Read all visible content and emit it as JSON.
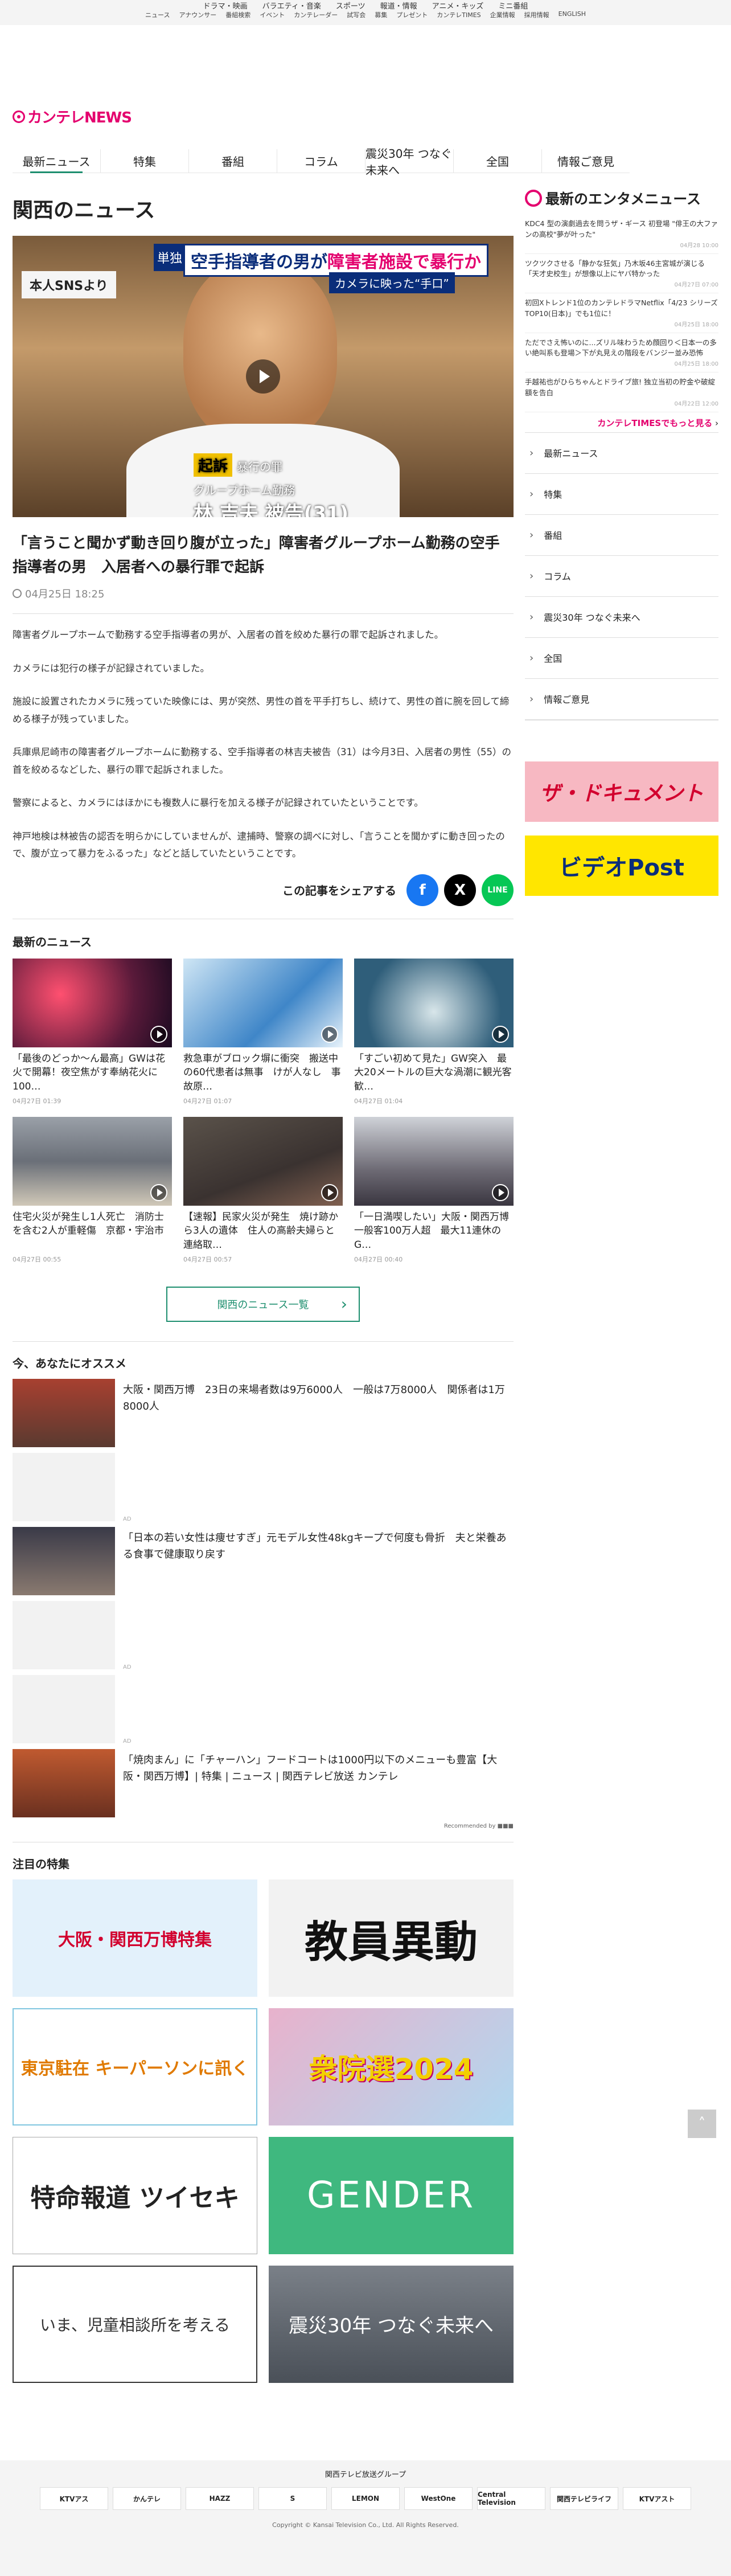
{
  "topbar": {
    "primary": [
      "ドラマ・映画",
      "バラエティ・音楽",
      "スポーツ",
      "報道・情報",
      "アニメ・キッズ",
      "ミニ番組"
    ],
    "secondary": [
      "ニュース",
      "アナウンサー",
      "番組検索",
      "イベント",
      "カンテレーダー",
      "試写会",
      "募集",
      "プレゼント",
      "カンテレTIMES",
      "企業情報",
      "採用情報",
      "ENGLISH"
    ]
  },
  "logo": {
    "text": "カンテレNEWS"
  },
  "nav": [
    "最新ニュース",
    "特集",
    "番組",
    "コラム",
    "震災30年 つなぐ未来へ",
    "全国",
    "情報ご意見"
  ],
  "page_title": "関西のニュース",
  "hero": {
    "tag": "単独",
    "top_text_a": "空手指導者の男が",
    "top_text_b": "障害者施設で暴行か",
    "sub": "カメラに映った“手口”",
    "sns": "本人SNSより",
    "cap_k": "起訴",
    "cap_k2": "暴行の罪",
    "cap_l2": "グループホーム勤務",
    "cap_l3": "林 吉夫 被告(31)"
  },
  "article": {
    "headline": "「言うこと聞かず動き回り腹が立った」障害者グループホーム勤務の空手指導者の男　入居者への暴行罪で起訴",
    "date": "04月25日 18:25",
    "paragraphs": [
      "障害者グループホームで勤務する空手指導者の男が、入居者の首を絞めた暴行の罪で起訴されました。",
      "カメラには犯行の様子が記録されていました。",
      "施設に設置されたカメラに残っていた映像には、男が突然、男性の首を平手打ちし、続けて、男性の首に腕を回して締める様子が残っていました。",
      "兵庫県尼崎市の障害者グループホームに勤務する、空手指導者の林吉夫被告（31）は今月3日、入居者の男性（55）の首を絞めるなどした、暴行の罪で起訴されました。",
      "警察によると、カメラにはほかにも複数人に暴行を加える様子が記録されていたということです。",
      "神戸地検は林被告の認否を明らかにしていませんが、逮捕時、警察の調べに対し、「言うことを聞かずに動き回ったので、腹が立って暴力をふるった」などと話していたということです。"
    ],
    "share_label": "この記事をシェアする"
  },
  "latest": {
    "title": "最新のニュース",
    "items": [
      {
        "title": "「最後のどっか〜ん最高」GWは花火で開幕！夜空焦がす奉納花火に100…",
        "date": "04月27日 01:39",
        "color": "#5a1a3a"
      },
      {
        "title": "救急車がブロック塀に衝突　搬送中の60代患者は無事　けが人なし　事故原…",
        "date": "04月27日 01:07",
        "color": "#3f86c8"
      },
      {
        "title": "「すごい初めて見た」GW突入　最大20メートルの巨大な渦潮に観光客歓…",
        "date": "04月27日 01:04",
        "color": "#2f5e7a"
      },
      {
        "title": "住宅火災が発生し1人死亡　消防士を含む2人が重軽傷　京都・宇治市",
        "date": "04月27日 00:55",
        "color": "#6a6f78"
      },
      {
        "title": "【速報】民家火災が発生　焼け跡から3人の遺体　住人の高齢夫婦らと連絡取…",
        "date": "04月27日 00:57",
        "color": "#3a3230"
      },
      {
        "title": "「一日満喫したい」大阪・関西万博　一般客100万人超　最大11連休のG…",
        "date": "04月27日 00:40",
        "color": "#6d6a74"
      }
    ],
    "more": "関西のニュース一覧"
  },
  "recommend": {
    "title": "今、あなたにオススメ",
    "items": [
      {
        "text": "大阪・関西万博　23日の来場者数は9万6000人　一般は7万8000人　関係者は1万8000人"
      },
      {
        "text": "「日本の若い女性は痩せすぎ」元モデル女性48kgキープで何度も骨折　夫と栄養ある食事で健康取り戻す"
      },
      {
        "text": "「焼肉まん」に「チャーハン」フードコートは1000円以下のメニューも豊富【大阪・関西万博】| 特集 | ニュース | 関西テレビ放送 カンテレ"
      }
    ],
    "ad_label": "AD",
    "recommended_by": "Recommended by"
  },
  "features": {
    "title": "注目の特集",
    "items": [
      {
        "label": "大阪・関西万博特集",
        "color": "#e3f1fb",
        "fg": "#d2002e"
      },
      {
        "label": "教員異動",
        "color": "#f2f2f2",
        "fg": "#111"
      },
      {
        "label": "東京駐在 キーパーソンに訊く",
        "color": "#ffffff",
        "fg": "#e07a00"
      },
      {
        "label": "衆院選2024",
        "color": "#e8b2cc",
        "fg": "#f3d000"
      },
      {
        "label": "特命報道 ツイセキ",
        "color": "#ffffff",
        "fg": "#222"
      },
      {
        "label": "GENDER",
        "color": "#3fb87f",
        "fg": "#ffffff"
      },
      {
        "label": "いま、児童相談所を考える",
        "color": "#ffffff",
        "fg": "#333"
      },
      {
        "label": "震災30年 つなぐ未来へ",
        "color": "#4a5058",
        "fg": "#ffffff"
      }
    ]
  },
  "side": {
    "title": "最新のエンタメニュース",
    "items": [
      {
        "t": "KDC4 型の演劇過去を問うザ・ギース 初登場 \"俳王の大ファンの高校\"夢が叶った\"",
        "d": "04月28 10:00"
      },
      {
        "t": "ツクツクさせる「静かな狂気」乃木坂46主宮城が演じる「天才史校生」が想像以上にヤバ特かった",
        "d": "04月27日 07:00"
      },
      {
        "t": "初回Xトレンド1位のカンテレドラマNetflix「4/23 シリーズTOP10(日本)」でも1位に！",
        "d": "04月25日 18:00"
      },
      {
        "t": "ただでさえ怖いのに...ズリル味わうため顔回り＜日本一の多い絶叫系も登場＞下が丸見えの階段をバンジー並み恐怖",
        "d": "04月25日 18:00"
      },
      {
        "t": "手越祐也がひらちゃんとドライブ旅! 独立当初の貯金や破綻額を告白",
        "d": "04月22日 12:00"
      }
    ],
    "times_link": "カンテレTIMESでもっと見る",
    "nav": [
      "最新ニュース",
      "特集",
      "番組",
      "コラム",
      "震災30年 つなぐ未来へ",
      "全国",
      "情報ご意見"
    ],
    "banner1": "ザ・ドキュメント",
    "banner2": "ビデオPost"
  },
  "footer": {
    "group": "関西テレビ放送グループ",
    "logos": [
      "KTVアス",
      "かんテレ",
      "HAZZ",
      "S",
      "LEMON",
      "WestOne",
      "Central Television",
      "関西テレビライフ",
      "KTVアスト"
    ],
    "copyright": "Copyright © Kansai Television Co., Ltd. All Rights Reserved."
  }
}
